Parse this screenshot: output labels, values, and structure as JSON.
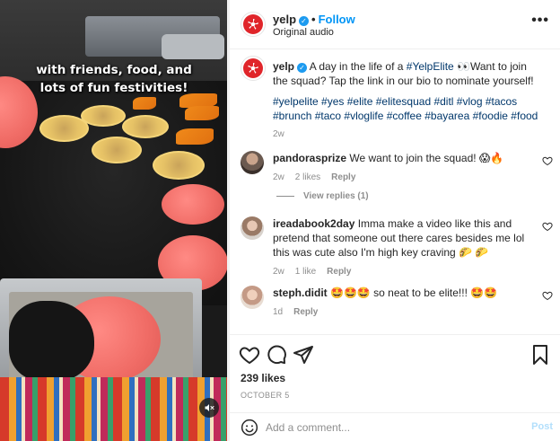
{
  "media": {
    "overlay_text_line1": "with friends, food, and",
    "overlay_text_line2": "lots of fun festivities!",
    "mute_icon": "speaker-muted-icon"
  },
  "header": {
    "username": "yelp",
    "separator": "•",
    "follow_label": "Follow",
    "audio_label": "Original audio",
    "more_label": "•••"
  },
  "caption": {
    "username": "yelp",
    "text_before_tag": "A day in the life of a ",
    "inline_tag": "#YelpElite",
    "text_after_tag": " 👀Want to join the squad? Tap the link in our bio to nominate yourself!",
    "hashtags": "#yelpelite #yes #elite #elitesquad #ditl #vlog #tacos #brunch #taco #vloglife #coffee #bayarea #foodie #food",
    "time": "2w"
  },
  "comments": [
    {
      "username": "pandorasprize",
      "text": "We want to join the squad! 😱🔥",
      "time": "2w",
      "likes": "2 likes",
      "reply_label": "Reply",
      "view_replies": "View replies (1)"
    },
    {
      "username": "ireadabook2day",
      "text": "Imma make a video like this and pretend that someone out there cares besides me lol this was cute also I'm high key craving 🌮 🌮",
      "time": "2w",
      "likes": "1 like",
      "reply_label": "Reply"
    },
    {
      "username": "steph.didit",
      "text": "🤩🤩🤩 so neat to be elite!!! 🤩🤩",
      "time": "1d",
      "reply_label": "Reply"
    }
  ],
  "footer": {
    "likes": "239 likes",
    "date": "OCTOBER 5",
    "comment_placeholder": "Add a comment...",
    "post_label": "Post"
  },
  "colors": {
    "brand_red": "#e0252a",
    "link_blue": "#0095f6",
    "hashtag_blue": "#00376b",
    "muted_gray": "#8e8e8e",
    "post_disabled": "#b2dffc"
  }
}
